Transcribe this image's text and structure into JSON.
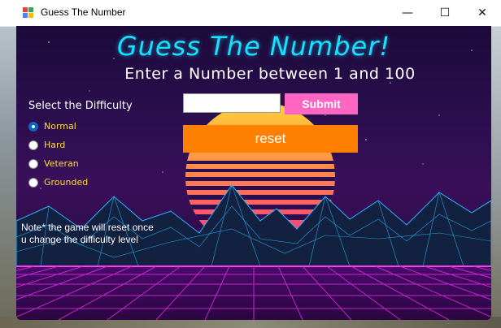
{
  "window": {
    "title": "Guess The Number",
    "controls": {
      "minimize": "—",
      "maximize": "☐",
      "close": "✕"
    }
  },
  "game": {
    "heading": "Guess The Number!",
    "subheading": "Enter a Number between 1 and 100",
    "input": {
      "value": "",
      "placeholder": ""
    },
    "submit_label": "Submit",
    "reset_label": "reset"
  },
  "difficulty": {
    "label": "Select the Difficulty",
    "options": [
      {
        "label": "Normal",
        "selected": true
      },
      {
        "label": "Hard",
        "selected": false
      },
      {
        "label": "Veteran",
        "selected": false
      },
      {
        "label": "Grounded",
        "selected": false
      }
    ]
  },
  "note": "Note* the game will reset once u change the difficulty level",
  "colors": {
    "heading": "#18e0ff",
    "submit_bg": "#ff66c4",
    "reset_bg": "#ff8000",
    "radio_label": "#ffdd33",
    "radio_selected": "#0a66c2"
  },
  "icons": {
    "app": "windows-forms-app-icon"
  }
}
